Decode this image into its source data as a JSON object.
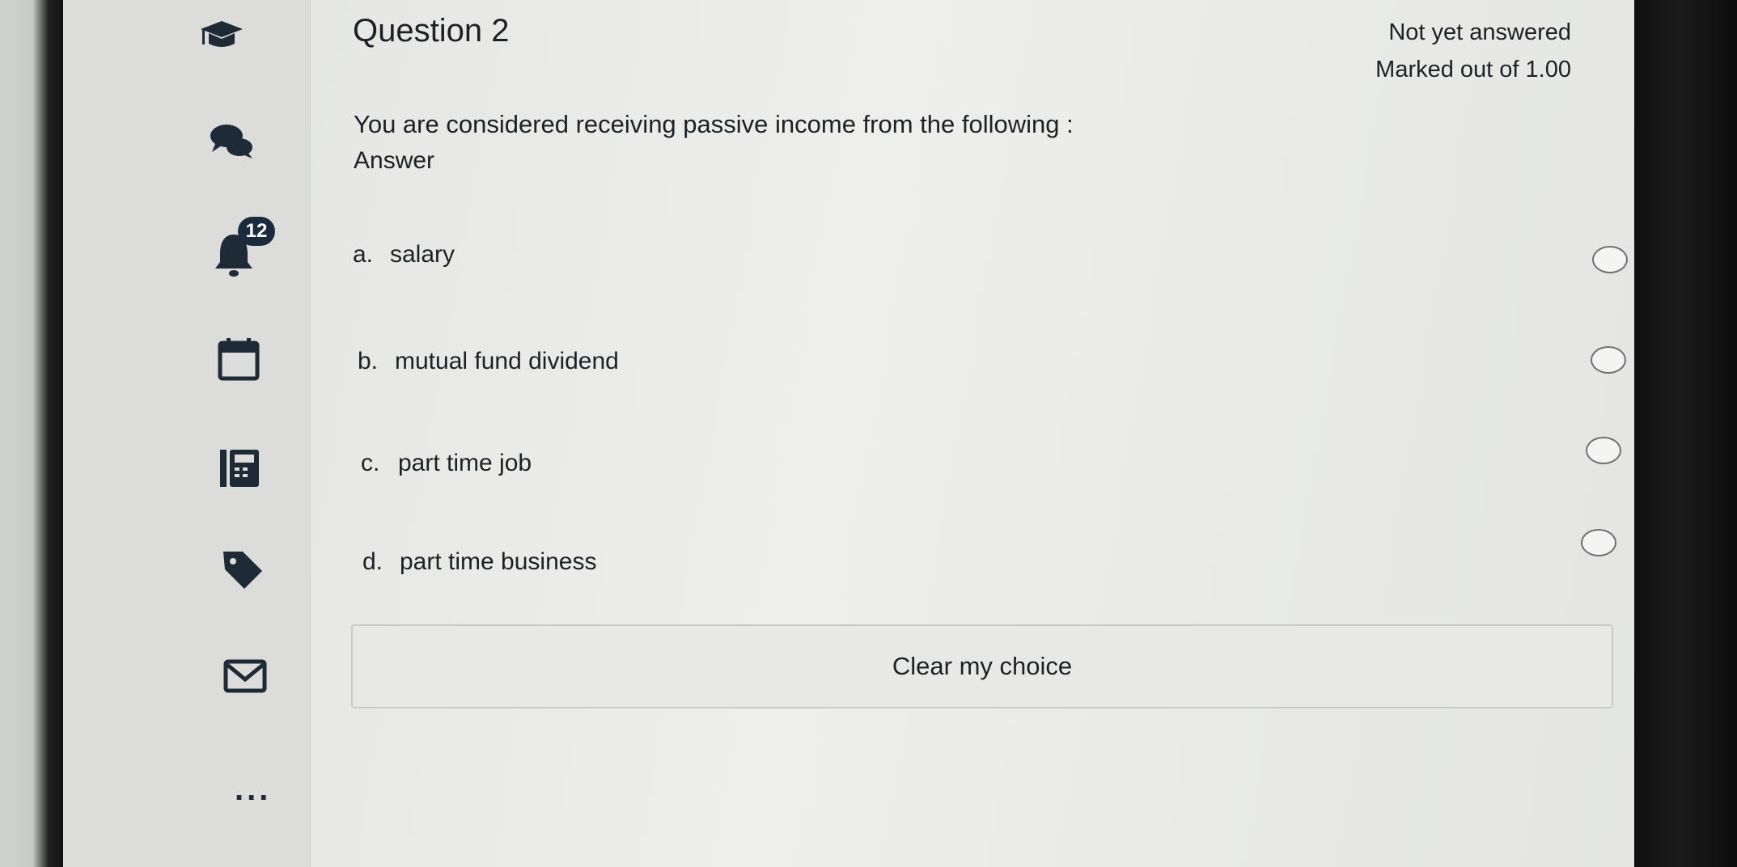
{
  "question": {
    "title": "Question 2",
    "status": "Not yet answered",
    "marks": "Marked out of 1.00",
    "text": "You are considered receiving passive income from the following :",
    "answer_label": "Answer",
    "options": [
      {
        "letter": "a.",
        "text": "salary"
      },
      {
        "letter": "b.",
        "text": "mutual fund dividend"
      },
      {
        "letter": "c.",
        "text": "part time job"
      },
      {
        "letter": "d.",
        "text": "part time business"
      }
    ],
    "clear_label": "Clear my choice"
  },
  "sidebar": {
    "icons": [
      "graduation-cap-icon",
      "chat-icon",
      "bell-icon",
      "calendar-icon",
      "gradebook-icon",
      "tag-icon",
      "mail-icon",
      "more-icon"
    ],
    "notification_count": "12",
    "more_label": "..."
  },
  "colors": {
    "text": "#1d2125",
    "icon": "#1e2a36",
    "badge": "#1b2a3c"
  }
}
